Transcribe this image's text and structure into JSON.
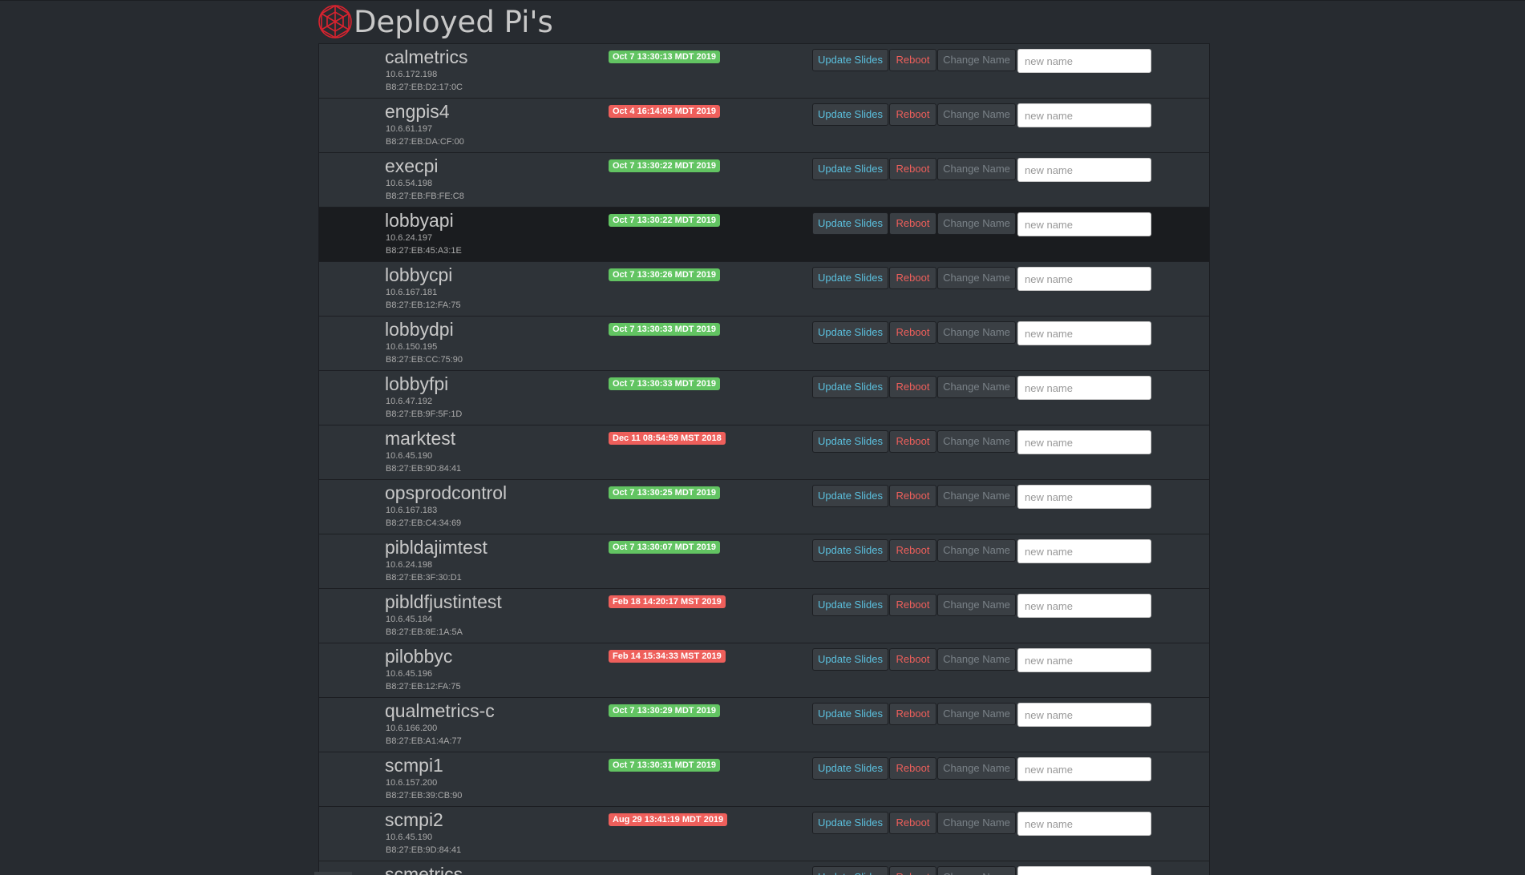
{
  "header": {
    "title": "Deployed Pi's",
    "logo_icon": "red-globe-icon",
    "logo_color": "#d9232f"
  },
  "colors": {
    "background": "#272b30",
    "row_background": "#2e3338",
    "status_ok": "#62c462",
    "status_stale": "#ee5f5b",
    "update_text": "#5bc0de",
    "reboot_text": "#ee5f5b"
  },
  "actions": {
    "update_label": "Update Slides",
    "reboot_label": "Reboot",
    "change_label": "Change Name",
    "input_placeholder": "new name"
  },
  "pis": [
    {
      "name": "calmetrics",
      "ip": "10.6.172.198",
      "mac": "B8:27:EB:D2:17:0C",
      "status": "Oct 7 13:30:13 MDT 2019",
      "status_color": "green"
    },
    {
      "name": "engpis4",
      "ip": "10.6.61.197",
      "mac": "B8:27:EB:DA:CF:00",
      "status": "Oct 4 16:14:05 MDT 2019",
      "status_color": "red"
    },
    {
      "name": "execpi",
      "ip": "10.6.54.198",
      "mac": "B8:27:EB:FB:FE:C8",
      "status": "Oct 7 13:30:22 MDT 2019",
      "status_color": "green"
    },
    {
      "name": "lobbyapi",
      "ip": "10.6.24.197",
      "mac": "B8:27:EB:45:A3:1E",
      "status": "Oct 7 13:30:22 MDT 2019",
      "status_color": "green",
      "active": true
    },
    {
      "name": "lobbycpi",
      "ip": "10.6.167.181",
      "mac": "B8:27:EB:12:FA:75",
      "status": "Oct 7 13:30:26 MDT 2019",
      "status_color": "green"
    },
    {
      "name": "lobbydpi",
      "ip": "10.6.150.195",
      "mac": "B8:27:EB:CC:75:90",
      "status": "Oct 7 13:30:33 MDT 2019",
      "status_color": "green"
    },
    {
      "name": "lobbyfpi",
      "ip": "10.6.47.192",
      "mac": "B8:27:EB:9F:5F:1D",
      "status": "Oct 7 13:30:33 MDT 2019",
      "status_color": "green"
    },
    {
      "name": "marktest",
      "ip": "10.6.45.190",
      "mac": "B8:27:EB:9D:84:41",
      "status": "Dec 11 08:54:59 MST 2018",
      "status_color": "red"
    },
    {
      "name": "opsprodcontrol",
      "ip": "10.6.167.183",
      "mac": "B8:27:EB:C4:34:69",
      "status": "Oct 7 13:30:25 MDT 2019",
      "status_color": "green"
    },
    {
      "name": "pibldajimtest",
      "ip": "10.6.24.198",
      "mac": "B8:27:EB:3F:30:D1",
      "status": "Oct 7 13:30:07 MDT 2019",
      "status_color": "green"
    },
    {
      "name": "pibldfjustintest",
      "ip": "10.6.45.184",
      "mac": "B8:27:EB:8E:1A:5A",
      "status": "Feb 18 14:20:17 MST 2019",
      "status_color": "red"
    },
    {
      "name": "pilobbyc",
      "ip": "10.6.45.196",
      "mac": "B8:27:EB:12:FA:75",
      "status": "Feb 14 15:34:33 MST 2019",
      "status_color": "red"
    },
    {
      "name": "qualmetrics-c",
      "ip": "10.6.166.200",
      "mac": "B8:27:EB:A1:4A:77",
      "status": "Oct 7 13:30:29 MDT 2019",
      "status_color": "green"
    },
    {
      "name": "scmpi1",
      "ip": "10.6.157.200",
      "mac": "B8:27:EB:39:CB:90",
      "status": "Oct 7 13:30:31 MDT 2019",
      "status_color": "green"
    },
    {
      "name": "scmpi2",
      "ip": "10.6.45.190",
      "mac": "B8:27:EB:9D:84:41",
      "status": "Aug 29 13:41:19 MDT 2019",
      "status_color": "red"
    },
    {
      "name": "scmetrics",
      "ip": "",
      "mac": "",
      "status": "",
      "status_color": "green"
    }
  ]
}
